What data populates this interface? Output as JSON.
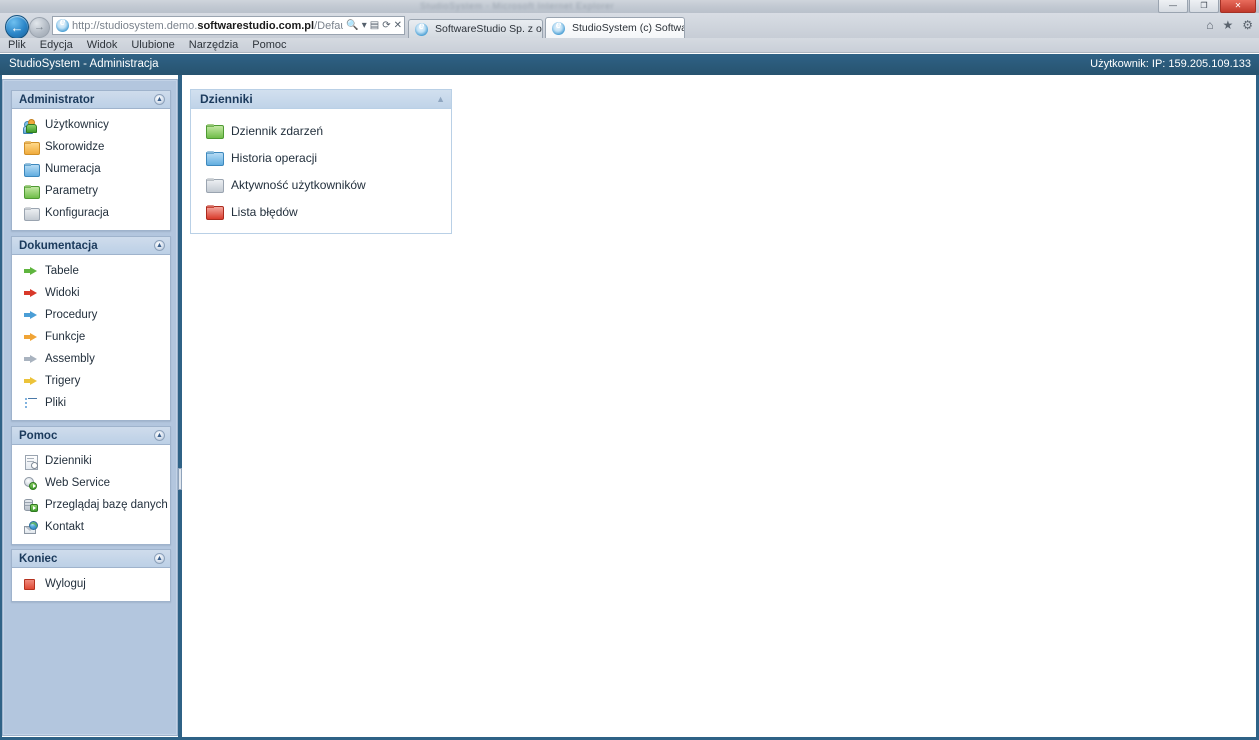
{
  "window": {
    "ghost_title": "StudioSystem  -  Microsoft Internet Explorer",
    "controls": [
      {
        "name": "minimize",
        "glyph": "—"
      },
      {
        "name": "maximize",
        "glyph": "❐"
      },
      {
        "name": "close",
        "glyph": "✕"
      }
    ]
  },
  "browser": {
    "back_glyph": "←",
    "forward_glyph": "→",
    "url_prefix": "http://studiosystem.demo.",
    "url_bold": "softwarestudio.com.pl",
    "url_suffix": "/DefaultAdministrator.aspx",
    "address_icons": [
      {
        "name": "search-icon",
        "glyph": "🔍"
      },
      {
        "name": "dropdown-icon",
        "glyph": "▾"
      },
      {
        "name": "compatibility-icon",
        "glyph": "▤"
      },
      {
        "name": "refresh-icon",
        "glyph": "⟳"
      },
      {
        "name": "stop-icon",
        "glyph": "✕"
      }
    ],
    "tabs": [
      {
        "label": "SoftwareStudio Sp. z o.o. prod...",
        "active": false
      },
      {
        "label": "StudioSystem (c) SoftwareS...",
        "active": true,
        "close_glyph": "✕"
      }
    ],
    "tool_icons": [
      {
        "name": "home-icon",
        "glyph": "⌂"
      },
      {
        "name": "favorites-icon",
        "glyph": "★"
      },
      {
        "name": "settings-icon",
        "glyph": "⚙"
      }
    ],
    "menu": [
      "Plik",
      "Edycja",
      "Widok",
      "Ulubione",
      "Narzędzia",
      "Pomoc"
    ]
  },
  "app_header": {
    "title": "StudioSystem - Administracja",
    "user_info": "Użytkownik: IP: 159.205.109.133"
  },
  "sidebar": {
    "collapse_glyph": "▲",
    "panels": [
      {
        "title": "Administrator",
        "items": [
          {
            "label": "Użytkownicy",
            "icon": "users-icon"
          },
          {
            "label": "Skorowidze",
            "icon": "folder-orange-icon"
          },
          {
            "label": "Numeracja",
            "icon": "folder-blue-icon"
          },
          {
            "label": "Parametry",
            "icon": "folder-green-icon"
          },
          {
            "label": "Konfiguracja",
            "icon": "folder-gray-icon"
          }
        ]
      },
      {
        "title": "Dokumentacja",
        "items": [
          {
            "label": "Tabele",
            "icon": "arrow-green-icon"
          },
          {
            "label": "Widoki",
            "icon": "arrow-red-icon"
          },
          {
            "label": "Procedury",
            "icon": "arrow-blue-icon"
          },
          {
            "label": "Funkcje",
            "icon": "arrow-orange-icon"
          },
          {
            "label": "Assembly",
            "icon": "arrow-gray-icon"
          },
          {
            "label": "Trigery",
            "icon": "arrow-yellow-icon"
          },
          {
            "label": "Pliki",
            "icon": "list-icon"
          }
        ]
      },
      {
        "title": "Pomoc",
        "items": [
          {
            "label": "Dzienniki",
            "icon": "document-clock-icon"
          },
          {
            "label": "Web Service",
            "icon": "gear-play-icon"
          },
          {
            "label": "Przeglądaj bazę danych",
            "icon": "database-play-icon"
          },
          {
            "label": "Kontakt",
            "icon": "mail-globe-icon"
          }
        ]
      },
      {
        "title": "Koniec",
        "items": [
          {
            "label": "Wyloguj",
            "icon": "stop-icon"
          }
        ]
      }
    ]
  },
  "main": {
    "panel": {
      "title": "Dzienniki",
      "collapse_glyph": "▲",
      "items": [
        {
          "label": "Dziennik zdarzeń",
          "icon": "folder-green-icon"
        },
        {
          "label": "Historia operacji",
          "icon": "folder-blue-icon"
        },
        {
          "label": "Aktywność użytkowników",
          "icon": "folder-gray-icon"
        },
        {
          "label": "Lista błędów",
          "icon": "folder-red-icon"
        }
      ]
    }
  },
  "colors": {
    "header_blue": "#2f6286",
    "sidebar_blue": "#b3c6de",
    "panel_head": "#c6d7ea"
  }
}
